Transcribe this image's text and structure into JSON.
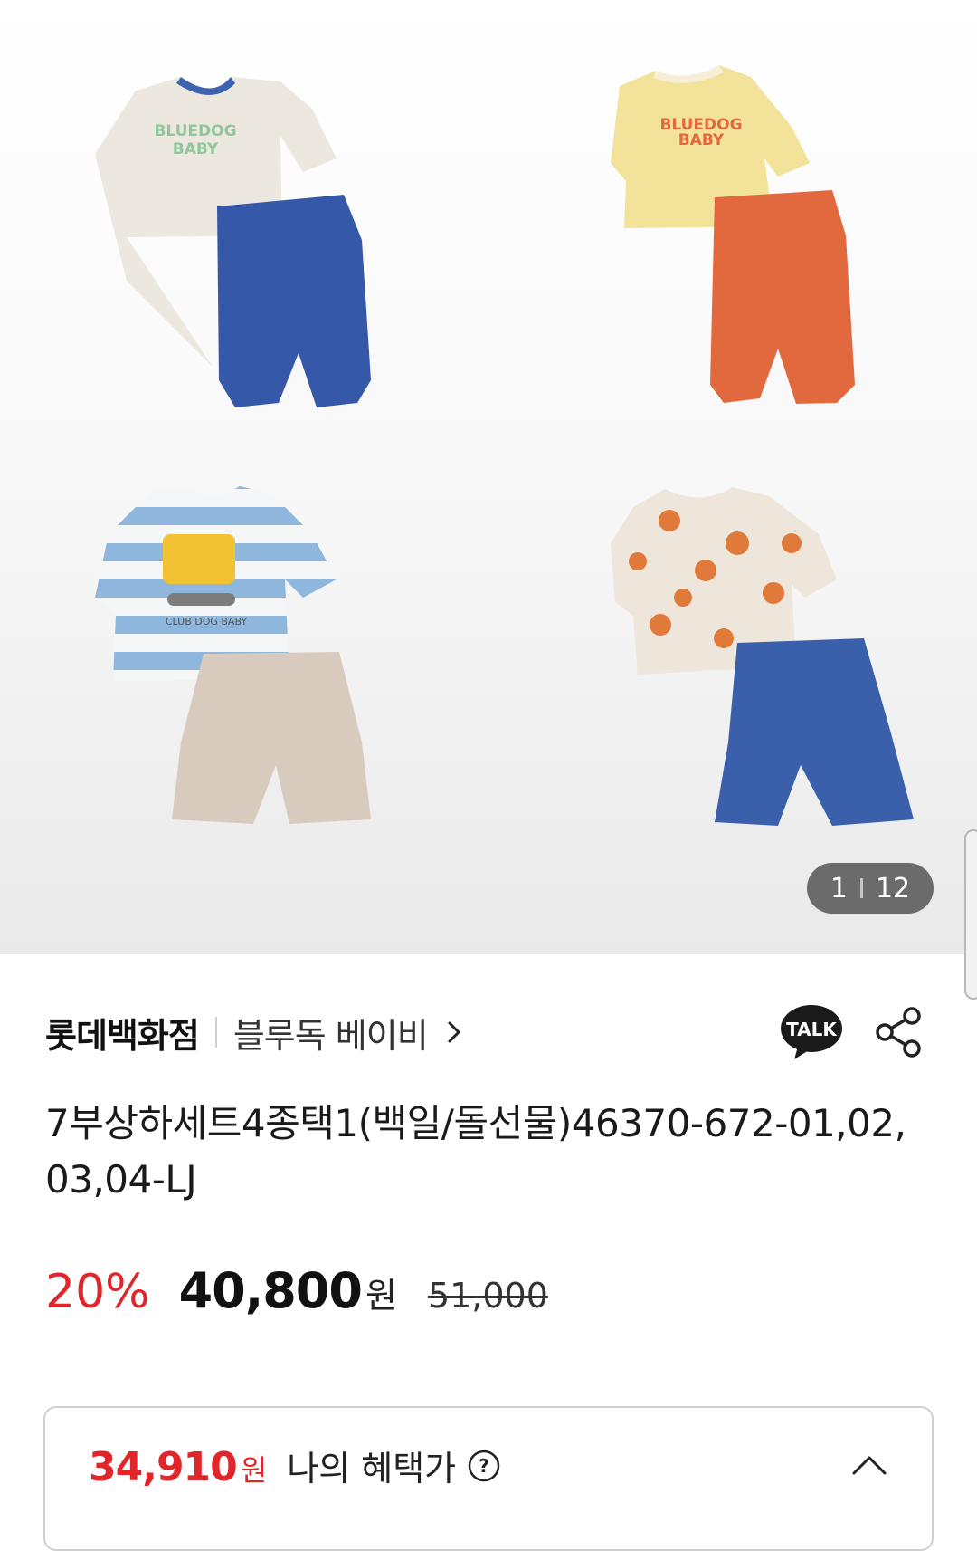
{
  "gallery": {
    "counter_current": "1",
    "counter_total": "12",
    "image_alt": "product-sets-image",
    "prints": {
      "tee1_print_line1": "BLUEDOG",
      "tee1_print_line2": "BABY",
      "tee2_print_line1": "BLUEDOG",
      "tee2_print_line2": "BABY",
      "tee3_print": "CLUB DOG BABY"
    }
  },
  "seller": {
    "store": "롯데백화점",
    "brand": "블루독 베이비"
  },
  "product": {
    "title": "7부상하세트4종택1(백일/돌선물)46370-672-01,02,03,04-LJ"
  },
  "price": {
    "discount": "20%",
    "sale": "40,800",
    "won": "원",
    "original": "51,000"
  },
  "benefit": {
    "price": "34,910",
    "won": "원",
    "label": "나의 혜택가"
  },
  "icons": {
    "talk": "TALK",
    "share": "share-icon",
    "help": "?",
    "brand_chevron": "chevron-right-icon",
    "collapse": "chevron-up-icon"
  },
  "colors": {
    "accent_red": "#e0262b",
    "kakao_black": "#1a1a1a"
  }
}
